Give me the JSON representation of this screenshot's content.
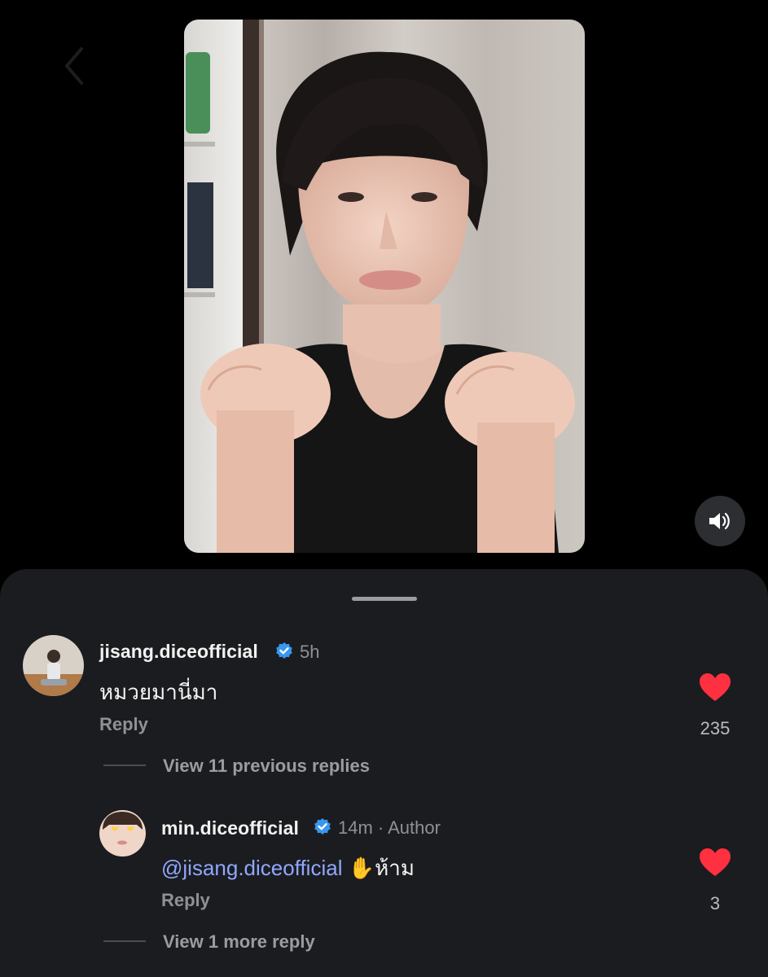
{
  "icons": {
    "back": "chevron-left-icon",
    "volume": "speaker-volume-icon",
    "verified": "verified-badge-icon",
    "like": "heart-icon",
    "emoji_hand": "raised-hand-emoji"
  },
  "colors": {
    "background": "#000000",
    "sheet": "#1b1c1f",
    "verified": "#3897f0",
    "like": "#ff3040",
    "mention": "#8fa7ff",
    "muted": "#8e9196"
  },
  "comments": [
    {
      "username": "jisang.diceofficial",
      "time": "5h",
      "text": "หมวยมานี่มา",
      "reply_label": "Reply",
      "likes": "235",
      "view_more": "View 11 previous replies"
    }
  ],
  "replies": [
    {
      "username": "min.diceofficial",
      "time_author": "14m · Author",
      "mention": "@jisang.diceofficial",
      "emoji": "✋",
      "text": "ห้าม",
      "reply_label": "Reply",
      "likes": "3",
      "view_more": "View 1 more reply"
    }
  ]
}
